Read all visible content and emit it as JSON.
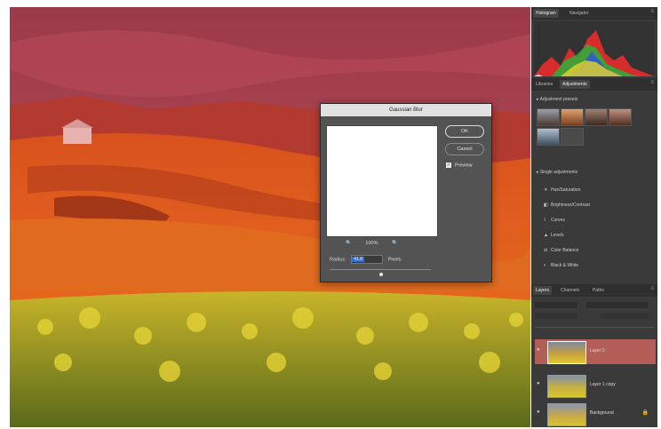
{
  "panels": {
    "histogram_tabs": [
      "Histogram",
      "Navigator"
    ],
    "adjust_tabs": [
      "Libraries",
      "Adjustments"
    ],
    "adjustment_presets_label": "Adjustment presets",
    "single_adjustments_label": "Single adjustments",
    "adjustments": [
      {
        "icon": "brightness-contrast-icon",
        "label": "Hue/Saturation"
      },
      {
        "icon": "levels-icon",
        "label": "Brightness/Contrast"
      },
      {
        "icon": "curves-icon",
        "label": "Curves"
      },
      {
        "icon": "levels-icon",
        "label": "Levels"
      },
      {
        "icon": "color-balance-icon",
        "label": "Color Balance"
      },
      {
        "icon": "bw-icon",
        "label": "Black & White"
      }
    ],
    "layers_tabs": [
      "Layers",
      "Channels",
      "Paths"
    ],
    "layers": [
      {
        "name": "Layer 0",
        "selected": true
      },
      {
        "name": "Layer 1 copy",
        "selected": false
      },
      {
        "name": "Background",
        "selected": false
      }
    ]
  },
  "dialog": {
    "title": "Gaussian Blur",
    "ok_label": "OK",
    "cancel_label": "Cancel",
    "preview_label": "Preview",
    "preview_checked": true,
    "zoom": "100%",
    "zoom_out": "🔍",
    "zoom_in": "🔍",
    "radius_label": "Radius:",
    "radius_value": "41.8",
    "radius_unit": "Pixels"
  },
  "colors": {
    "panel_bg": "#3a3a3a",
    "selected_layer": "#b35f58",
    "dialog_bg": "#535353"
  }
}
